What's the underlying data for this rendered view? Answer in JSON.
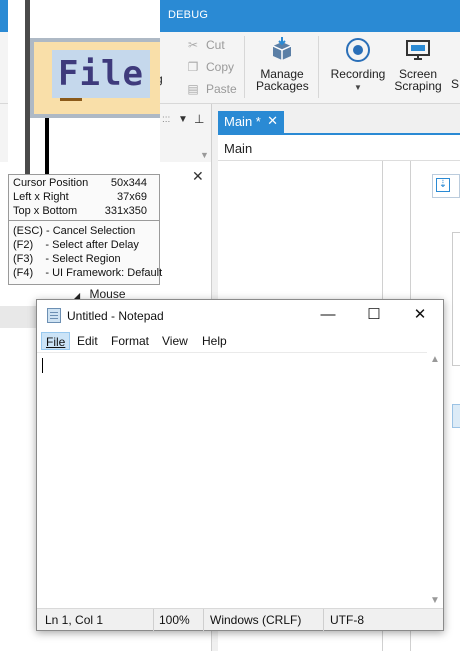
{
  "studio": {
    "title_partial": "DEBUG",
    "ribbon": {
      "cut": "Cut",
      "copy": "Copy",
      "paste": "Paste",
      "partial_label": "g",
      "manage_packages": [
        "Manage",
        "Packages"
      ],
      "recording": "Recording",
      "screen_scraping": [
        "Screen",
        "Scraping"
      ],
      "edge_label": "S"
    },
    "tab_label": "Main *",
    "breadcrumb": "Main",
    "tree_item": "Mouse"
  },
  "notepad": {
    "title": "Untitled - Notepad",
    "menu": [
      {
        "label": "File",
        "active": true
      },
      {
        "label": "Edit",
        "active": false
      },
      {
        "label": "Format",
        "active": false
      },
      {
        "label": "View",
        "active": false
      },
      {
        "label": "Help",
        "active": false
      }
    ],
    "status": {
      "position": "Ln 1, Col 1",
      "zoom": "100%",
      "line_endings": "Windows (CRLF)",
      "encoding": "UTF-8"
    }
  },
  "magnifier": {
    "preview_text": "File",
    "info": {
      "cursor_label": "Cursor Position",
      "cursor_value": "50x344",
      "lr_label": "Left x Right",
      "lr_value": "37x69",
      "tb_label": "Top x Bottom",
      "tb_value": "331x350"
    },
    "shortcuts": [
      "(ESC) - Cancel Selection",
      "(F2)    - Select after Delay",
      "(F3)    - Select Region",
      "(F4)    - UI Framework: Default"
    ]
  }
}
